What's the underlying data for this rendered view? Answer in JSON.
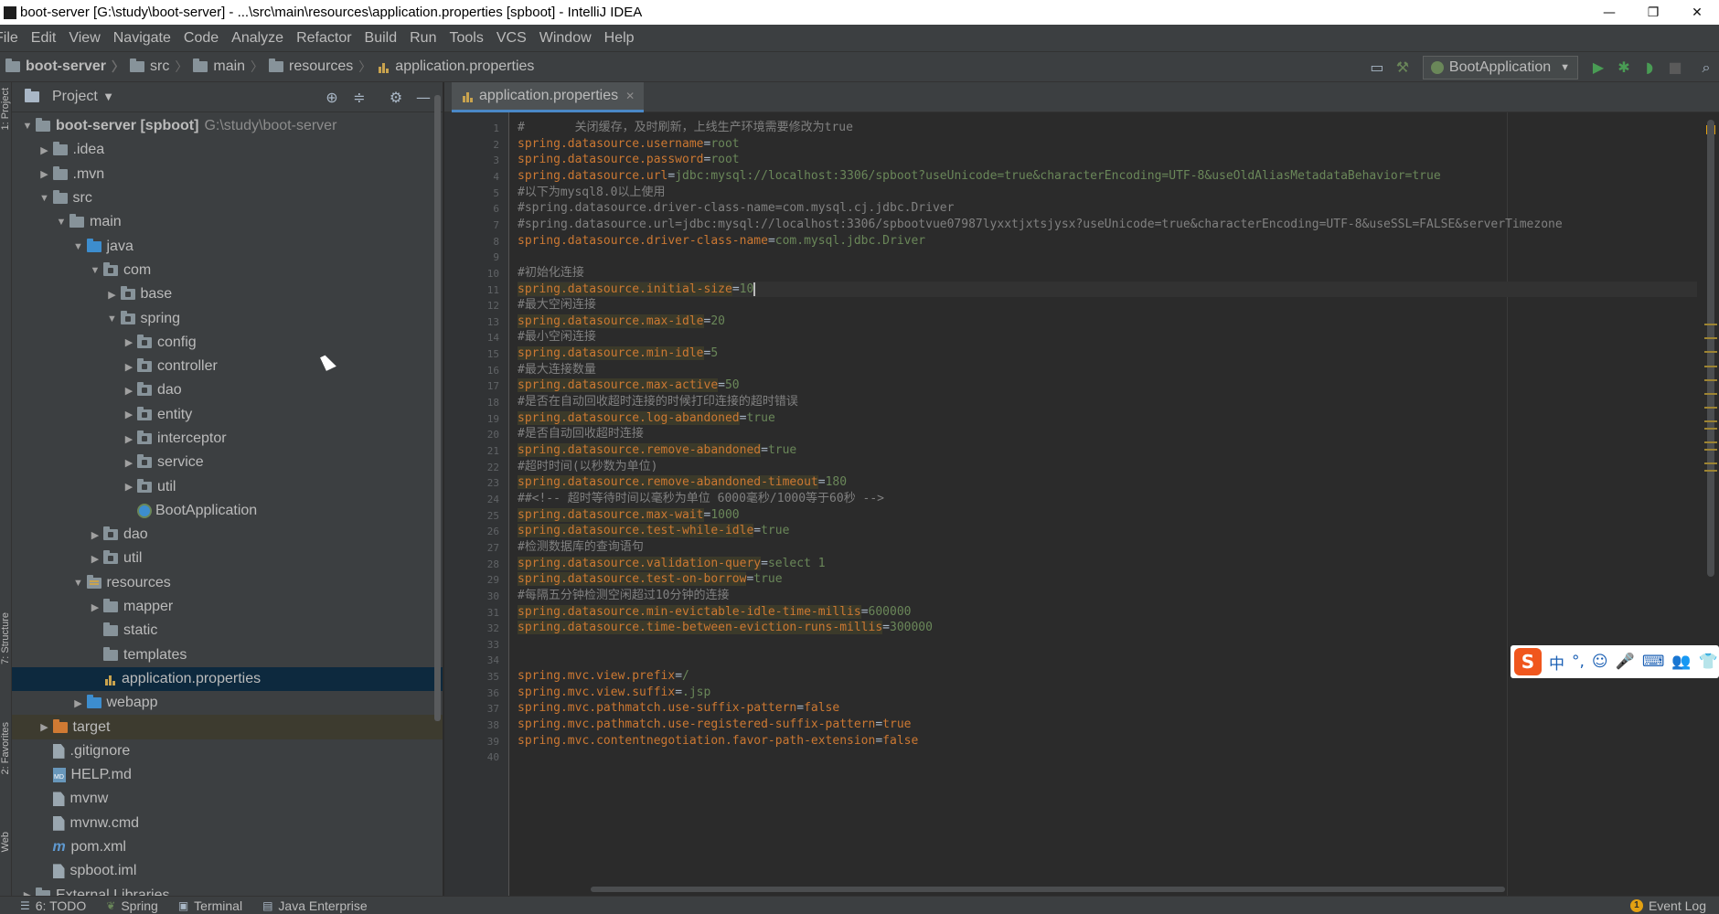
{
  "window": {
    "title": "boot-server [G:\\study\\boot-server] - ...\\src\\main\\resources\\application.properties [spboot] - IntelliJ IDEA",
    "controls": [
      "—",
      "❐",
      "✕"
    ]
  },
  "menu": [
    "File",
    "Edit",
    "View",
    "Navigate",
    "Code",
    "Analyze",
    "Refactor",
    "Build",
    "Run",
    "Tools",
    "VCS",
    "Window",
    "Help"
  ],
  "breadcrumb": [
    "boot-server",
    "src",
    "main",
    "resources",
    "application.properties"
  ],
  "toolbar": {
    "run_config": "BootApplication"
  },
  "left_strip": {
    "project_tab": "1: Project",
    "structure_tab": "7: Structure",
    "favorites_tab": "2: Favorites",
    "web_tab": "Web"
  },
  "project_panel": {
    "title": "Project",
    "tree": [
      {
        "depth": 0,
        "arrow": "▼",
        "icon": "folder-gray",
        "label": "boot-server [spboot]",
        "path": "G:\\study\\boot-server",
        "bold": true
      },
      {
        "depth": 1,
        "arrow": "▶",
        "icon": "folder-gray",
        "label": ".idea"
      },
      {
        "depth": 1,
        "arrow": "▶",
        "icon": "folder-gray",
        "label": ".mvn"
      },
      {
        "depth": 1,
        "arrow": "▼",
        "icon": "folder-gray",
        "label": "src"
      },
      {
        "depth": 2,
        "arrow": "▼",
        "icon": "folder-gray",
        "label": "main"
      },
      {
        "depth": 3,
        "arrow": "▼",
        "icon": "folder-blue",
        "label": "java"
      },
      {
        "depth": 4,
        "arrow": "▼",
        "icon": "package",
        "label": "com"
      },
      {
        "depth": 5,
        "arrow": "▶",
        "icon": "package",
        "label": "base"
      },
      {
        "depth": 5,
        "arrow": "▼",
        "icon": "package",
        "label": "spring"
      },
      {
        "depth": 6,
        "arrow": "▶",
        "icon": "package",
        "label": "config"
      },
      {
        "depth": 6,
        "arrow": "▶",
        "icon": "package",
        "label": "controller"
      },
      {
        "depth": 6,
        "arrow": "▶",
        "icon": "package",
        "label": "dao"
      },
      {
        "depth": 6,
        "arrow": "▶",
        "icon": "package",
        "label": "entity"
      },
      {
        "depth": 6,
        "arrow": "▶",
        "icon": "package",
        "label": "interceptor"
      },
      {
        "depth": 6,
        "arrow": "▶",
        "icon": "package",
        "label": "service"
      },
      {
        "depth": 6,
        "arrow": "▶",
        "icon": "package",
        "label": "util"
      },
      {
        "depth": 6,
        "arrow": "",
        "icon": "boot-class",
        "label": "BootApplication"
      },
      {
        "depth": 4,
        "arrow": "▶",
        "icon": "package",
        "label": "dao"
      },
      {
        "depth": 4,
        "arrow": "▶",
        "icon": "package",
        "label": "util"
      },
      {
        "depth": 3,
        "arrow": "▼",
        "icon": "resources",
        "label": "resources"
      },
      {
        "depth": 4,
        "arrow": "▶",
        "icon": "folder-gray",
        "label": "mapper"
      },
      {
        "depth": 4,
        "arrow": "",
        "icon": "folder-gray",
        "label": "static"
      },
      {
        "depth": 4,
        "arrow": "",
        "icon": "folder-gray",
        "label": "templates"
      },
      {
        "depth": 4,
        "arrow": "",
        "icon": "props-file",
        "label": "application.properties",
        "selected": true
      },
      {
        "depth": 3,
        "arrow": "▶",
        "icon": "folder-blue",
        "label": "webapp"
      },
      {
        "depth": 1,
        "arrow": "▶",
        "icon": "folder-orange",
        "label": "target",
        "target": true
      },
      {
        "depth": 1,
        "arrow": "",
        "icon": "file",
        "label": ".gitignore"
      },
      {
        "depth": 1,
        "arrow": "",
        "icon": "md-file",
        "label": "HELP.md"
      },
      {
        "depth": 1,
        "arrow": "",
        "icon": "file",
        "label": "mvnw"
      },
      {
        "depth": 1,
        "arrow": "",
        "icon": "file",
        "label": "mvnw.cmd"
      },
      {
        "depth": 1,
        "arrow": "",
        "icon": "maven",
        "label": "pom.xml"
      },
      {
        "depth": 1,
        "arrow": "",
        "icon": "file",
        "label": "spboot.iml"
      },
      {
        "depth": 0,
        "arrow": "▶",
        "icon": "folder-gray",
        "label": "External Libraries"
      }
    ]
  },
  "editor": {
    "tab_label": "application.properties",
    "current_line": 11,
    "lines": [
      {
        "n": "1",
        "type": "comment",
        "text": "#       关闭缓存，及时刷新，上线生产环境需要修改为true"
      },
      {
        "n": "2",
        "type": "prop",
        "key": "spring.datasource.username",
        "value": "root"
      },
      {
        "n": "3",
        "type": "prop",
        "key": "spring.datasource.password",
        "value": "root"
      },
      {
        "n": "4",
        "type": "prop",
        "key": "spring.datasource.url",
        "value": "jdbc:mysql://localhost:3306/spboot?useUnicode=true&characterEncoding=UTF-8&useOldAliasMetadataBehavior=true"
      },
      {
        "n": "5",
        "type": "comment",
        "text": "#以下为mysql8.0以上使用"
      },
      {
        "n": "6",
        "type": "comment",
        "text": "#spring.datasource.driver-class-name=com.mysql.cj.jdbc.Driver"
      },
      {
        "n": "7",
        "type": "comment",
        "text": "#spring.datasource.url=jdbc:mysql://localhost:3306/spbootvue07987lyxxtjxtsjysx?useUnicode=true&characterEncoding=UTF-8&useSSL=FALSE&serverTimezone"
      },
      {
        "n": "8",
        "type": "prop",
        "key": "spring.datasource.driver-class-name",
        "value": "com.mysql.jdbc.Driver"
      },
      {
        "n": "9",
        "type": "blank"
      },
      {
        "n": "10",
        "type": "comment",
        "text": "#初始化连接"
      },
      {
        "n": "11",
        "type": "prop",
        "key": "spring.datasource.initial-size",
        "value": "10",
        "hl": true
      },
      {
        "n": "12",
        "type": "comment",
        "text": "#最大空闲连接"
      },
      {
        "n": "13",
        "type": "prop",
        "key": "spring.datasource.max-idle",
        "value": "20",
        "hl": true
      },
      {
        "n": "14",
        "type": "comment",
        "text": "#最小空闲连接"
      },
      {
        "n": "15",
        "type": "prop",
        "key": "spring.datasource.min-idle",
        "value": "5",
        "hl": true
      },
      {
        "n": "16",
        "type": "comment",
        "text": "#最大连接数量"
      },
      {
        "n": "17",
        "type": "prop",
        "key": "spring.datasource.max-active",
        "value": "50",
        "hl": true
      },
      {
        "n": "18",
        "type": "comment",
        "text": "#是否在自动回收超时连接的时候打印连接的超时错误"
      },
      {
        "n": "19",
        "type": "prop",
        "key": "spring.datasource.log-abandoned",
        "value": "true",
        "hl": true
      },
      {
        "n": "20",
        "type": "comment",
        "text": "#是否自动回收超时连接"
      },
      {
        "n": "21",
        "type": "prop",
        "key": "spring.datasource.remove-abandoned",
        "value": "true",
        "hl": true
      },
      {
        "n": "22",
        "type": "comment",
        "text": "#超时时间(以秒数为单位)"
      },
      {
        "n": "23",
        "type": "prop",
        "key": "spring.datasource.remove-abandoned-timeout",
        "value": "180",
        "hl": true
      },
      {
        "n": "24",
        "type": "comment",
        "text": "##<!-- 超时等待时间以毫秒为单位 6000毫秒/1000等于60秒 -->"
      },
      {
        "n": "25",
        "type": "prop",
        "key": "spring.datasource.max-wait",
        "value": "1000",
        "hl": true
      },
      {
        "n": "26",
        "type": "prop",
        "key": "spring.datasource.test-while-idle",
        "value": "true",
        "hl": true
      },
      {
        "n": "27",
        "type": "comment",
        "text": "#检测数据库的查询语句"
      },
      {
        "n": "28",
        "type": "prop",
        "key": "spring.datasource.validation-query",
        "value": "select 1",
        "hl": true
      },
      {
        "n": "29",
        "type": "prop",
        "key": "spring.datasource.test-on-borrow",
        "value": "true",
        "hl": true
      },
      {
        "n": "30",
        "type": "comment",
        "text": "#每隔五分钟检测空闲超过10分钟的连接"
      },
      {
        "n": "31",
        "type": "prop",
        "key": "spring.datasource.min-evictable-idle-time-millis",
        "value": "600000",
        "hl": true
      },
      {
        "n": "32",
        "type": "prop",
        "key": "spring.datasource.time-between-eviction-runs-millis",
        "value": "300000",
        "hl": true
      },
      {
        "n": "33",
        "type": "blank"
      },
      {
        "n": "34",
        "type": "blank"
      },
      {
        "n": "35",
        "type": "prop",
        "key": "spring.mvc.view.prefix",
        "value": "/"
      },
      {
        "n": "36",
        "type": "prop",
        "key": "spring.mvc.view.suffix",
        "value": ".jsp"
      },
      {
        "n": "37",
        "type": "prop",
        "key": "spring.mvc.pathmatch.use-suffix-pattern",
        "value": "false",
        "kwval": true
      },
      {
        "n": "38",
        "type": "prop",
        "key": "spring.mvc.pathmatch.use-registered-suffix-pattern",
        "value": "true",
        "kwval": true
      },
      {
        "n": "39",
        "type": "prop",
        "key": "spring.mvc.contentnegotiation.favor-path-extension",
        "value": "false",
        "kwval": true
      },
      {
        "n": "40",
        "type": "blank"
      }
    ]
  },
  "ime": {
    "logo": "S",
    "icons": [
      "中",
      "°,",
      "☺",
      "🎤",
      "⌨",
      "👥",
      "👕"
    ]
  },
  "statusbar": {
    "tabs": [
      "6: TODO",
      "Spring",
      "Terminal",
      "Java Enterprise"
    ],
    "event_log": "Event Log",
    "event_count": "1"
  },
  "colors": {
    "key": "#cc7832",
    "value": "#6a8759",
    "comment": "#808080",
    "selection": "#0d293e"
  }
}
